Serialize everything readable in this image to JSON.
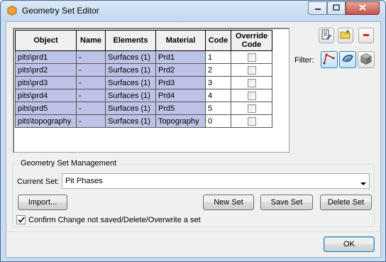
{
  "window": {
    "title": "Geometry Set Editor",
    "icon": "hexagon-icon"
  },
  "grid": {
    "columns": [
      "Object",
      "Name",
      "Elements",
      "Material",
      "Code",
      "Override Code"
    ],
    "rows": [
      {
        "object": "pits\\prd1",
        "name": "-",
        "elements": "Surfaces (1)",
        "material": "Prd1",
        "code": "1",
        "override": false
      },
      {
        "object": "pits\\prd2",
        "name": "-",
        "elements": "Surfaces (1)",
        "material": "Prd2",
        "code": "2",
        "override": false
      },
      {
        "object": "pits\\prd3",
        "name": "-",
        "elements": "Surfaces (1)",
        "material": "Prd3",
        "code": "3",
        "override": false
      },
      {
        "object": "pits\\prd4",
        "name": "-",
        "elements": "Surfaces (1)",
        "material": "Prd4",
        "code": "4",
        "override": false
      },
      {
        "object": "pits\\prd5",
        "name": "-",
        "elements": "Surfaces (1)",
        "material": "Prd5",
        "code": "5",
        "override": false
      },
      {
        "object": "pits\\topography",
        "name": "-",
        "elements": "Surfaces (1)",
        "material": "Topography",
        "code": "0",
        "override": false
      }
    ]
  },
  "toolbar": {
    "icons": [
      "list-edit-icon",
      "folder-add-icon",
      "remove-icon"
    ]
  },
  "filter": {
    "label": "Filter:",
    "icons": [
      "polyline-filter-icon",
      "surface-filter-icon",
      "solid-filter-icon"
    ]
  },
  "management": {
    "title": "Geometry Set Management",
    "current_set_label": "Current Set:",
    "current_set_value": "Pit Phases",
    "import_label": "Import...",
    "new_set_label": "New Set",
    "save_set_label": "Save Set",
    "delete_set_label": "Delete Set"
  },
  "confirm": {
    "label": "Confirm Change not saved/Delete/Overwrite a set",
    "checked": true
  },
  "ok_label": "OK",
  "colors": {
    "row_highlight": "#bcc3e6",
    "window_frame": "#c7dbf1",
    "remove_red": "#d9261c"
  }
}
